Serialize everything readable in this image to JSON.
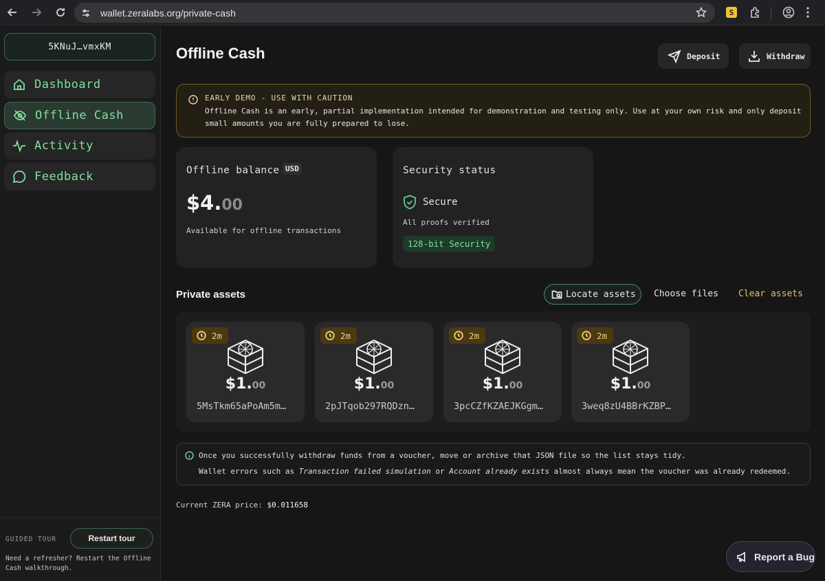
{
  "browser": {
    "url": "wallet.zeralabs.org/private-cash",
    "ext_badge": "S"
  },
  "sidebar": {
    "wallet_address": "5KNuJ…vmxKM",
    "items": [
      {
        "label": "Dashboard",
        "icon": "home-icon"
      },
      {
        "label": "Offline Cash",
        "icon": "eye-off-icon",
        "active": true
      },
      {
        "label": "Activity",
        "icon": "activity-icon"
      },
      {
        "label": "Feedback",
        "icon": "chat-icon"
      }
    ],
    "guided_tour_label": "GUIDED TOUR",
    "restart_tour": "Restart tour",
    "tour_help": "Need a refresher? Restart the Offline Cash walkthrough."
  },
  "page": {
    "title": "Offline Cash",
    "deposit": "Deposit",
    "withdraw": "Withdraw"
  },
  "warning": {
    "title": "EARLY DEMO - USE WITH CAUTION",
    "text": "Offline Cash is an early, partial implementation intended for demonstration and testing only. Use at your own risk and only deposit small amounts you are fully prepared to lose."
  },
  "balance_card": {
    "label": "Offline balance",
    "currency": "USD",
    "amount_main": "$4.",
    "amount_cents": "00",
    "subtitle": "Available for offline transactions"
  },
  "security_card": {
    "label": "Security status",
    "status": "Secure",
    "proofs": "All proofs verified",
    "badge": "128-bit Security"
  },
  "assets": {
    "title": "Private assets",
    "locate": "Locate assets",
    "choose": "Choose files",
    "clear": "Clear assets",
    "items": [
      {
        "timer": "2m",
        "amount_main": "$1.",
        "amount_cents": "00",
        "id": "5MsTkm65aPoAm5m…"
      },
      {
        "timer": "2m",
        "amount_main": "$1.",
        "amount_cents": "00",
        "id": "2pJTqob297RQDzn…"
      },
      {
        "timer": "2m",
        "amount_main": "$1.",
        "amount_cents": "00",
        "id": "3pcCZfKZAEJKGgm…"
      },
      {
        "timer": "2m",
        "amount_main": "$1.",
        "amount_cents": "00",
        "id": "3weq8zU4BBrKZBP…"
      }
    ]
  },
  "info": {
    "line1": "Once you successfully withdraw funds from a voucher, move or archive that JSON file so the list stays tidy.",
    "line2_a": "Wallet errors such as ",
    "line2_em1": "Transaction failed simulation",
    "line2_b": " or ",
    "line2_em2": "Account already exists",
    "line2_c": " almost always mean the voucher was already redeemed."
  },
  "price": {
    "label": "Current ZERA price: ",
    "value": "$0.011658"
  },
  "report_bug": "Report a Bug"
}
